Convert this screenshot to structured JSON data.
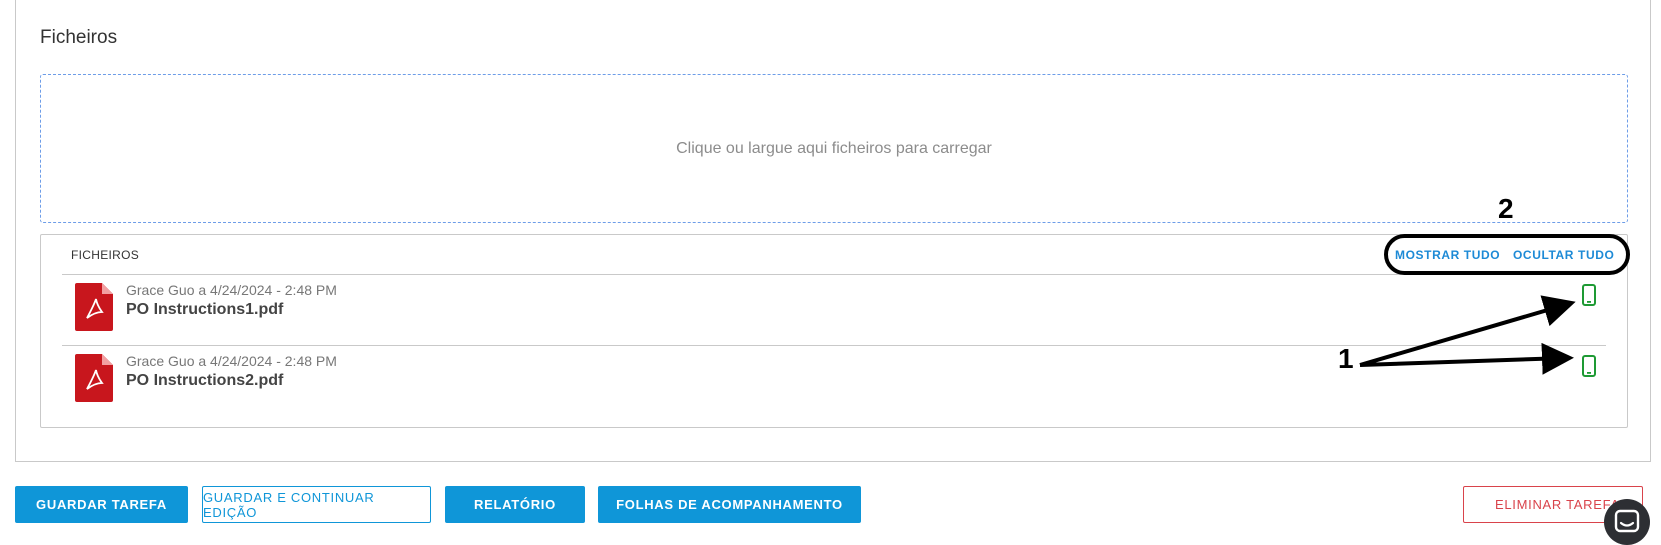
{
  "section": {
    "title": "Ficheiros"
  },
  "dropzone": {
    "text": "Clique ou largue aqui ficheiros para carregar"
  },
  "files_panel": {
    "header_label": "FICHEIROS",
    "show_all_label": "MOSTRAR TUDO",
    "hide_all_label": "OCULTAR TUDO",
    "files": [
      {
        "meta": "Grace Guo a 4/24/2024 - 2:48 PM",
        "name": "PO Instructions1.pdf",
        "icon": "pdf-icon",
        "status_icon": "mobile-icon"
      },
      {
        "meta": "Grace Guo a 4/24/2024 - 2:48 PM",
        "name": "PO Instructions2.pdf",
        "icon": "pdf-icon",
        "status_icon": "mobile-icon"
      }
    ]
  },
  "actions": {
    "save_task": "GUARDAR TAREFA",
    "save_continue": "GUARDAR E CONTINUAR EDIÇÃO",
    "report": "RELATÓRIO",
    "timesheets": "FOLHAS DE ACOMPANHAMENTO",
    "delete_task": "ELIMINAR TAREFA"
  },
  "annotations": {
    "label_1": "1",
    "label_2": "2"
  },
  "colors": {
    "accent": "#0f96d8",
    "danger": "#d9434b",
    "pdf_red": "#c8161d",
    "mobile_green": "#1e9a34",
    "dropzone_border": "#6d9de8"
  }
}
